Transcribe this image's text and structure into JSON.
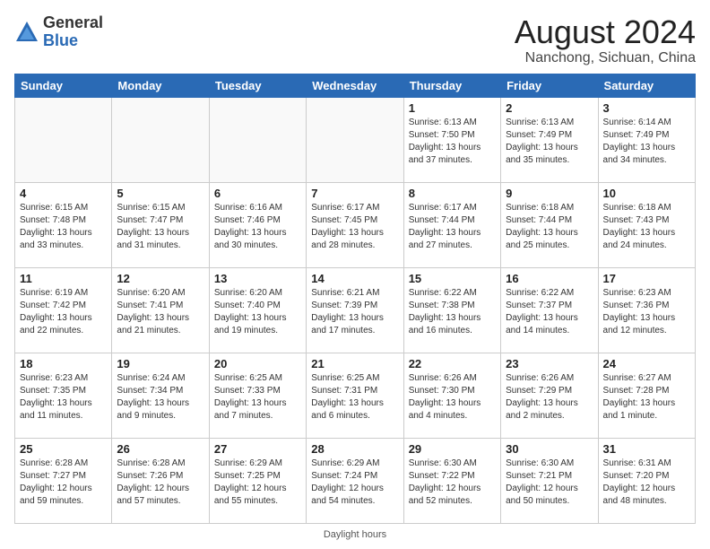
{
  "logo": {
    "general": "General",
    "blue": "Blue"
  },
  "header": {
    "month_year": "August 2024",
    "location": "Nanchong, Sichuan, China"
  },
  "days_of_week": [
    "Sunday",
    "Monday",
    "Tuesday",
    "Wednesday",
    "Thursday",
    "Friday",
    "Saturday"
  ],
  "footer": {
    "daylight_hours": "Daylight hours"
  },
  "weeks": [
    {
      "days": [
        {
          "num": "",
          "info": "",
          "empty": true
        },
        {
          "num": "",
          "info": "",
          "empty": true
        },
        {
          "num": "",
          "info": "",
          "empty": true
        },
        {
          "num": "",
          "info": "",
          "empty": true
        },
        {
          "num": "1",
          "info": "Sunrise: 6:13 AM\nSunset: 7:50 PM\nDaylight: 13 hours\nand 37 minutes.",
          "empty": false
        },
        {
          "num": "2",
          "info": "Sunrise: 6:13 AM\nSunset: 7:49 PM\nDaylight: 13 hours\nand 35 minutes.",
          "empty": false
        },
        {
          "num": "3",
          "info": "Sunrise: 6:14 AM\nSunset: 7:49 PM\nDaylight: 13 hours\nand 34 minutes.",
          "empty": false
        }
      ]
    },
    {
      "days": [
        {
          "num": "4",
          "info": "Sunrise: 6:15 AM\nSunset: 7:48 PM\nDaylight: 13 hours\nand 33 minutes.",
          "empty": false
        },
        {
          "num": "5",
          "info": "Sunrise: 6:15 AM\nSunset: 7:47 PM\nDaylight: 13 hours\nand 31 minutes.",
          "empty": false
        },
        {
          "num": "6",
          "info": "Sunrise: 6:16 AM\nSunset: 7:46 PM\nDaylight: 13 hours\nand 30 minutes.",
          "empty": false
        },
        {
          "num": "7",
          "info": "Sunrise: 6:17 AM\nSunset: 7:45 PM\nDaylight: 13 hours\nand 28 minutes.",
          "empty": false
        },
        {
          "num": "8",
          "info": "Sunrise: 6:17 AM\nSunset: 7:44 PM\nDaylight: 13 hours\nand 27 minutes.",
          "empty": false
        },
        {
          "num": "9",
          "info": "Sunrise: 6:18 AM\nSunset: 7:44 PM\nDaylight: 13 hours\nand 25 minutes.",
          "empty": false
        },
        {
          "num": "10",
          "info": "Sunrise: 6:18 AM\nSunset: 7:43 PM\nDaylight: 13 hours\nand 24 minutes.",
          "empty": false
        }
      ]
    },
    {
      "days": [
        {
          "num": "11",
          "info": "Sunrise: 6:19 AM\nSunset: 7:42 PM\nDaylight: 13 hours\nand 22 minutes.",
          "empty": false
        },
        {
          "num": "12",
          "info": "Sunrise: 6:20 AM\nSunset: 7:41 PM\nDaylight: 13 hours\nand 21 minutes.",
          "empty": false
        },
        {
          "num": "13",
          "info": "Sunrise: 6:20 AM\nSunset: 7:40 PM\nDaylight: 13 hours\nand 19 minutes.",
          "empty": false
        },
        {
          "num": "14",
          "info": "Sunrise: 6:21 AM\nSunset: 7:39 PM\nDaylight: 13 hours\nand 17 minutes.",
          "empty": false
        },
        {
          "num": "15",
          "info": "Sunrise: 6:22 AM\nSunset: 7:38 PM\nDaylight: 13 hours\nand 16 minutes.",
          "empty": false
        },
        {
          "num": "16",
          "info": "Sunrise: 6:22 AM\nSunset: 7:37 PM\nDaylight: 13 hours\nand 14 minutes.",
          "empty": false
        },
        {
          "num": "17",
          "info": "Sunrise: 6:23 AM\nSunset: 7:36 PM\nDaylight: 13 hours\nand 12 minutes.",
          "empty": false
        }
      ]
    },
    {
      "days": [
        {
          "num": "18",
          "info": "Sunrise: 6:23 AM\nSunset: 7:35 PM\nDaylight: 13 hours\nand 11 minutes.",
          "empty": false
        },
        {
          "num": "19",
          "info": "Sunrise: 6:24 AM\nSunset: 7:34 PM\nDaylight: 13 hours\nand 9 minutes.",
          "empty": false
        },
        {
          "num": "20",
          "info": "Sunrise: 6:25 AM\nSunset: 7:33 PM\nDaylight: 13 hours\nand 7 minutes.",
          "empty": false
        },
        {
          "num": "21",
          "info": "Sunrise: 6:25 AM\nSunset: 7:31 PM\nDaylight: 13 hours\nand 6 minutes.",
          "empty": false
        },
        {
          "num": "22",
          "info": "Sunrise: 6:26 AM\nSunset: 7:30 PM\nDaylight: 13 hours\nand 4 minutes.",
          "empty": false
        },
        {
          "num": "23",
          "info": "Sunrise: 6:26 AM\nSunset: 7:29 PM\nDaylight: 13 hours\nand 2 minutes.",
          "empty": false
        },
        {
          "num": "24",
          "info": "Sunrise: 6:27 AM\nSunset: 7:28 PM\nDaylight: 13 hours\nand 1 minute.",
          "empty": false
        }
      ]
    },
    {
      "days": [
        {
          "num": "25",
          "info": "Sunrise: 6:28 AM\nSunset: 7:27 PM\nDaylight: 12 hours\nand 59 minutes.",
          "empty": false
        },
        {
          "num": "26",
          "info": "Sunrise: 6:28 AM\nSunset: 7:26 PM\nDaylight: 12 hours\nand 57 minutes.",
          "empty": false
        },
        {
          "num": "27",
          "info": "Sunrise: 6:29 AM\nSunset: 7:25 PM\nDaylight: 12 hours\nand 55 minutes.",
          "empty": false
        },
        {
          "num": "28",
          "info": "Sunrise: 6:29 AM\nSunset: 7:24 PM\nDaylight: 12 hours\nand 54 minutes.",
          "empty": false
        },
        {
          "num": "29",
          "info": "Sunrise: 6:30 AM\nSunset: 7:22 PM\nDaylight: 12 hours\nand 52 minutes.",
          "empty": false
        },
        {
          "num": "30",
          "info": "Sunrise: 6:30 AM\nSunset: 7:21 PM\nDaylight: 12 hours\nand 50 minutes.",
          "empty": false
        },
        {
          "num": "31",
          "info": "Sunrise: 6:31 AM\nSunset: 7:20 PM\nDaylight: 12 hours\nand 48 minutes.",
          "empty": false
        }
      ]
    }
  ]
}
